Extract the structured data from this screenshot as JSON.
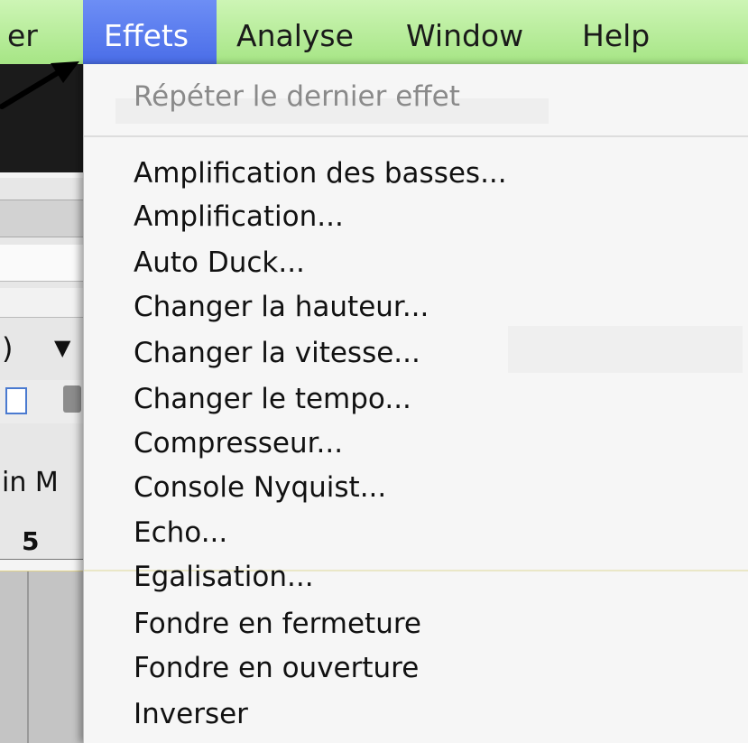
{
  "menubar": {
    "items": [
      {
        "label": "er",
        "active": false
      },
      {
        "label": "Effets",
        "active": true
      },
      {
        "label": "Analyse",
        "active": false
      },
      {
        "label": "Window",
        "active": false
      },
      {
        "label": "Help",
        "active": false
      }
    ]
  },
  "effets_menu": {
    "repeat_last": "Répéter le dernier effet",
    "items": [
      "Amplification des basses...",
      "Amplification...",
      "Auto Duck...",
      "Changer la hauteur...",
      "Changer la vitesse...",
      "Changer le tempo...",
      "Compresseur...",
      "Console Nyquist...",
      "Echo...",
      "Egalisation...",
      "Fondre en fermeture",
      "Fondre en ouverture",
      "Inverser"
    ]
  },
  "background_app": {
    "dropdown_fragment": ")",
    "label_fragment": "in M",
    "ruler_fragment": "5"
  },
  "colors": {
    "menubar": "#b3eb95",
    "menu_highlight": "#5a7cef",
    "disabled_text": "#8a8a8a"
  }
}
